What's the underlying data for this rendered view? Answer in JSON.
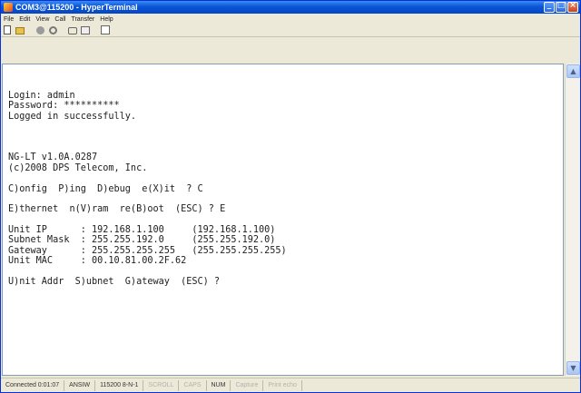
{
  "window": {
    "title": "COM3@115200 - HyperTerminal"
  },
  "menu": [
    "File",
    "Edit",
    "View",
    "Call",
    "Transfer",
    "Help"
  ],
  "toolbar": {
    "buttons": [
      "new-document-icon",
      "open-folder-icon",
      "connect-icon",
      "disconnect-icon",
      "send-icon",
      "receive-icon",
      "properties-icon"
    ]
  },
  "terminal": {
    "lines": [
      "Login: admin",
      "Password: **********",
      "Logged in successfully.",
      "",
      "",
      "",
      "NG-LT v1.0A.0287",
      "(c)2008 DPS Telecom, Inc.",
      "",
      "C)onfig  P)ing  D)ebug  e(X)it  ? C",
      "",
      "E)thernet  n(V)ram  re(B)oot  (ESC) ? E",
      "",
      "Unit IP      : 192.168.1.100     (192.168.1.100)",
      "Subnet Mask  : 255.255.192.0     (255.255.192.0)",
      "Gateway      : 255.255.255.255   (255.255.255.255)",
      "Unit MAC     : 00.10.81.00.2F.62",
      "",
      "U)nit Addr  S)ubnet  G)ateway  (ESC) ?"
    ]
  },
  "status": {
    "connected": "Connected 0:01:07",
    "emulation": "ANSIW",
    "port_settings": "115200 8-N-1",
    "scroll": "SCROLL",
    "caps": "CAPS",
    "num": "NUM",
    "capture": "Capture",
    "print_echo": "Print echo"
  },
  "colors": {
    "titlebar": "#0a55d6",
    "terminal_bg": "#ffffff",
    "terminal_text": "#202020"
  }
}
